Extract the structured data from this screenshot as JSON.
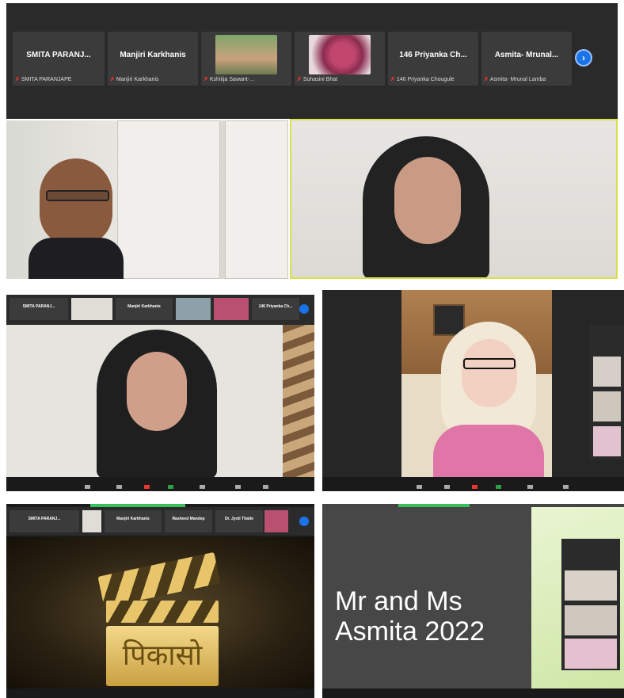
{
  "top_strip": {
    "participants": [
      {
        "name": "SMITA PARANJ...",
        "label": "SMITA PARANJAPE"
      },
      {
        "name": "Manjiri Karkhanis",
        "label": "Manjiri Karkhanis"
      },
      {
        "name": "",
        "label": "Kshitija Sawant-..."
      },
      {
        "name": "",
        "label": "Suhasini Bhat"
      },
      {
        "name": "146 Priyanka Ch...",
        "label": "146 Priyanka Chougule"
      },
      {
        "name": "Asmita- Mrunal...",
        "label": "Asmita- Mrunal Lamba"
      }
    ],
    "next_icon": "›"
  },
  "panel_strip": {
    "names": [
      "SMITA PARANJ...",
      "Manjiri Karkhanis",
      "146 Priyanka Ch..."
    ],
    "names_b": [
      "SMITA PARANJ...",
      "Manjiri Karkhanis",
      "Rasheed Mandep",
      "Dr. Jyoti Thatte"
    ]
  },
  "logo": {
    "text": "पिकासो"
  },
  "slide": {
    "line1": "Mr and Ms",
    "line2": "Asmita  2022"
  },
  "colors": {
    "accent": "#1a73e8",
    "active_border": "#d8e04a",
    "green": "#35c15c"
  }
}
